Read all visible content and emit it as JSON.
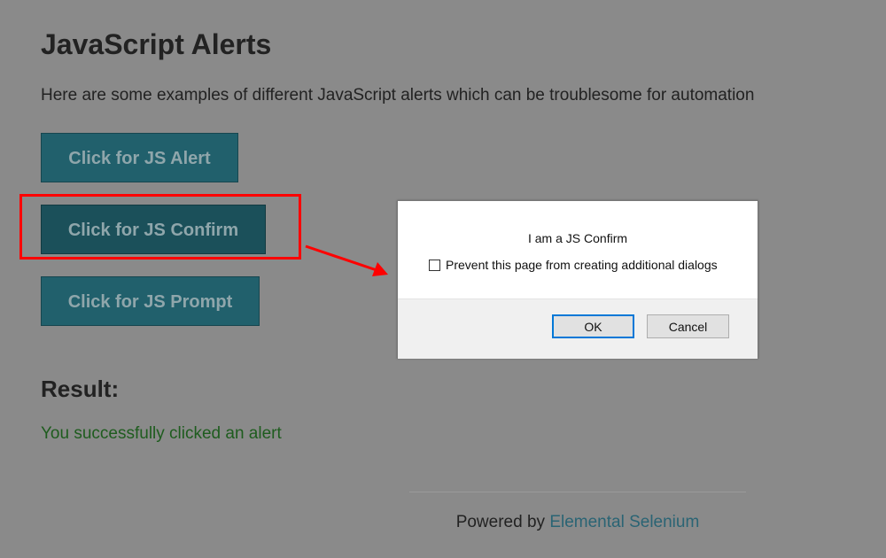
{
  "page": {
    "title": "JavaScript Alerts",
    "intro": "Here are some examples of different JavaScript alerts which can be troublesome for automation"
  },
  "buttons": {
    "alert_label": "Click for JS Alert",
    "confirm_label": "Click for JS Confirm",
    "prompt_label": "Click for JS Prompt"
  },
  "result": {
    "heading": "Result:",
    "text": "You successfully clicked an alert"
  },
  "footer": {
    "prefix": "Powered by ",
    "link_text": "Elemental Selenium"
  },
  "dialog": {
    "message": "I am a JS Confirm",
    "checkbox_label": "Prevent this page from creating additional dialogs",
    "checkbox_checked": false,
    "ok_label": "OK",
    "cancel_label": "Cancel"
  },
  "annotation": {
    "highlight_color": "#ff0000"
  },
  "colors": {
    "button_bg": "#21606c",
    "result_text": "#1e5c1e",
    "link": "#2a6474",
    "overlay": "#8a8a8a"
  }
}
